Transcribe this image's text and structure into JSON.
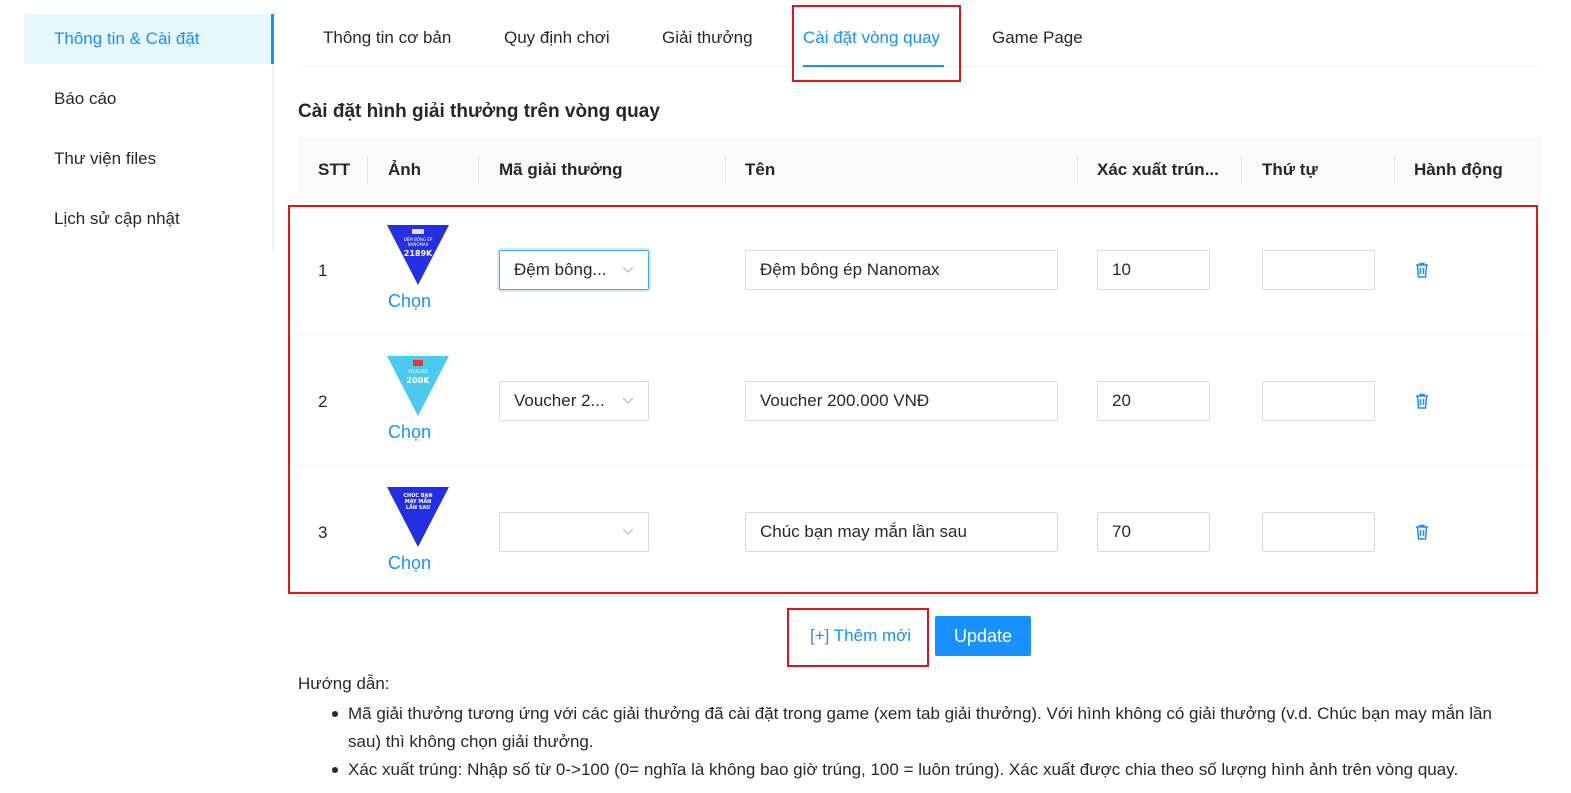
{
  "sidebar": {
    "items": [
      {
        "label": "Thông tin & Cài đặt",
        "active": true
      },
      {
        "label": "Báo cáo"
      },
      {
        "label": "Thư viện files"
      },
      {
        "label": "Lịch sử cập nhật"
      }
    ]
  },
  "tabs": [
    {
      "label": "Thông tin cơ bản"
    },
    {
      "label": "Quy định chơi"
    },
    {
      "label": "Giải thưởng"
    },
    {
      "label": "Cài đặt vòng quay",
      "active": true
    },
    {
      "label": "Game Page"
    }
  ],
  "section": {
    "title": "Cài đặt hình giải thưởng trên vòng quay"
  },
  "table": {
    "columns": [
      "STT",
      "Ảnh",
      "Mã giải thưởng",
      "Tên",
      "Xác xuất trún...",
      "Thứ tự",
      "Hành động"
    ],
    "rows": [
      {
        "stt": "1",
        "thumb_lines": [
          "ĐỆM BÔNG ÉP",
          "NANOMAX",
          "2189K"
        ],
        "thumb_color": "#2430e0",
        "choose": "Chọn",
        "code": "Đệm bông...",
        "name": "Đệm bông ép Nanomax",
        "prob": "10",
        "order": ""
      },
      {
        "stt": "2",
        "thumb_lines": [
          "VOUCHER",
          "200K"
        ],
        "thumb_color": "#4cc9ef",
        "choose": "Chọn",
        "code": "Voucher 2...",
        "name": "Voucher 200.000 VNĐ",
        "prob": "20",
        "order": ""
      },
      {
        "stt": "3",
        "thumb_lines": [
          "CHÚC BẠN",
          "MAY MẮN",
          "LẦN SAU"
        ],
        "thumb_color": "#2430e0",
        "choose": "Chọn",
        "code": "",
        "name": "Chúc bạn may mắn lần sau",
        "prob": "70",
        "order": ""
      }
    ]
  },
  "actions": {
    "add_label": "[+] Thêm mới",
    "update_label": "Update"
  },
  "guide": {
    "title": "Hướng dẫn:",
    "items": [
      "Mã giải thưởng tương ứng với các giải thưởng đã cài đặt trong game (xem tab giải thưởng). Với hình không có giải thưởng (v.d. Chúc bạn may mắn lần sau) thì không chọn giải thưởng.",
      "Xác xuất trúng: Nhập số từ 0->100 (0= nghĩa là không bao giờ trúng, 100 = luôn trúng). Xác xuất được chia theo số lượng hình ảnh trên vòng quay."
    ]
  },
  "colors": {
    "primary": "#1890ff",
    "highlight": "#e0141e",
    "header_bg": "#fafafa"
  }
}
